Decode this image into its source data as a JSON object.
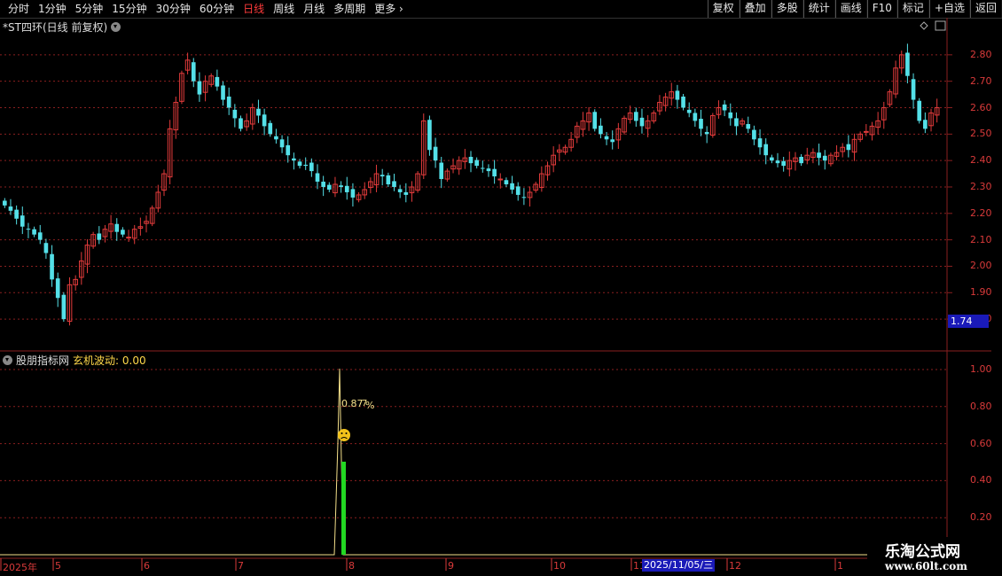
{
  "toolbar": {
    "left_items": [
      {
        "label": "分时",
        "active": false
      },
      {
        "label": "1分钟",
        "active": false
      },
      {
        "label": "5分钟",
        "active": false
      },
      {
        "label": "15分钟",
        "active": false
      },
      {
        "label": "30分钟",
        "active": false
      },
      {
        "label": "60分钟",
        "active": false
      },
      {
        "label": "日线",
        "active": true
      },
      {
        "label": "周线",
        "active": false
      },
      {
        "label": "月线",
        "active": false
      },
      {
        "label": "多周期",
        "active": false
      },
      {
        "label": "更多",
        "active": false
      }
    ],
    "right_buttons": [
      "复权",
      "叠加",
      "多股",
      "统计",
      "画线",
      "F10",
      "标记",
      "+自选",
      "返回"
    ]
  },
  "main_chart": {
    "title": "*ST四环(日线 前复权)",
    "y_ticks": [
      "2.80",
      "2.70",
      "2.60",
      "2.50",
      "2.40",
      "2.30",
      "2.20",
      "2.10",
      "2.00",
      "1.90",
      "1.80"
    ],
    "current_price_label": "1.74"
  },
  "indicator": {
    "source": "股朋指标网",
    "name": "玄机波动: 0.00",
    "y_ticks": [
      "1.00",
      "0.80",
      "0.60",
      "0.40",
      "0.20"
    ],
    "annotation": "0.87",
    "annotation_suffix": "%",
    "annotation_mark": "7",
    "smiley_icon": "sad-face-icon"
  },
  "time_axis": {
    "labels": [
      "2025年",
      "5",
      "6",
      "7",
      "8",
      "9",
      "10",
      "11",
      "12",
      "1"
    ],
    "cursor_date": "2025/11/05/三"
  },
  "watermark": {
    "line1": "乐淘公式网",
    "line2": "www.60lt.com"
  },
  "colors": {
    "up": "#e23b3b",
    "down": "#54e0e8",
    "grid": "#8a1f1f",
    "indicator_line": "#f4e08a",
    "indicator_bar": "#22d822",
    "cursor_badge": "#1a1ab8"
  },
  "chart_data": {
    "type": "candlestick",
    "ylim": [
      1.74,
      2.88
    ],
    "close_series": [
      2.23,
      2.21,
      2.18,
      2.15,
      2.14,
      2.12,
      2.1,
      2.05,
      1.95,
      1.88,
      1.8,
      1.93,
      1.95,
      2.02,
      2.08,
      2.12,
      2.1,
      2.14,
      2.16,
      2.13,
      2.12,
      2.11,
      2.14,
      2.15,
      2.17,
      2.22,
      2.28,
      2.35,
      2.52,
      2.62,
      2.73,
      2.78,
      2.7,
      2.65,
      2.7,
      2.72,
      2.68,
      2.63,
      2.6,
      2.56,
      2.52,
      2.55,
      2.6,
      2.57,
      2.53,
      2.5,
      2.48,
      2.45,
      2.42,
      2.4,
      2.38,
      2.38,
      2.36,
      2.32,
      2.3,
      2.29,
      2.31,
      2.3,
      2.28,
      2.26,
      2.27,
      2.29,
      2.32,
      2.35,
      2.34,
      2.31,
      2.3,
      2.28,
      2.27,
      2.3,
      2.35,
      2.55,
      2.44,
      2.4,
      2.33,
      2.36,
      2.38,
      2.4,
      2.41,
      2.39,
      2.38,
      2.37,
      2.36,
      2.34,
      2.33,
      2.31,
      2.29,
      2.27,
      2.26,
      2.28,
      2.31,
      2.35,
      2.38,
      2.42,
      2.44,
      2.45,
      2.48,
      2.53,
      2.55,
      2.58,
      2.52,
      2.5,
      2.48,
      2.47,
      2.52,
      2.56,
      2.58,
      2.55,
      2.53,
      2.55,
      2.58,
      2.62,
      2.64,
      2.66,
      2.63,
      2.6,
      2.58,
      2.55,
      2.52,
      2.5,
      2.57,
      2.6,
      2.59,
      2.56,
      2.53,
      2.55,
      2.52,
      2.48,
      2.45,
      2.42,
      2.4,
      2.39,
      2.38,
      2.4,
      2.41,
      2.39,
      2.42,
      2.43,
      2.41,
      2.4,
      2.42,
      2.43,
      2.45,
      2.44,
      2.48,
      2.5,
      2.51,
      2.53,
      2.55,
      2.6,
      2.66,
      2.75,
      2.8,
      2.72,
      2.63,
      2.55,
      2.52,
      2.58,
      2.6
    ]
  }
}
